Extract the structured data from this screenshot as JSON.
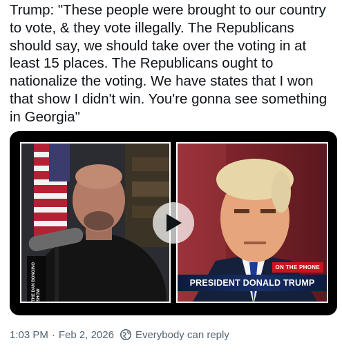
{
  "post": {
    "text": "Trump: \"These people were brought to our country to vote, & they vote illegally. The Republicans should say, we should take over the voting in at least 15 places. The Republicans ought to nationalize the voting. We have states that I won that show I didn't win. You're gonna see something in Georgia\""
  },
  "video": {
    "left_logo": "THE DAN BONGINO SHOW",
    "on_phone": "ON THE PHONE",
    "caption": "PRESIDENT DONALD TRUMP"
  },
  "meta": {
    "time": "1:03 PM",
    "separator": "·",
    "date": "Feb 2, 2026",
    "reply_setting": "Everybody can reply"
  },
  "colors": {
    "text": "#0f1419",
    "secondary": "#536471",
    "chyron_red": "#c8161d",
    "chyron_navy": "#183069"
  }
}
